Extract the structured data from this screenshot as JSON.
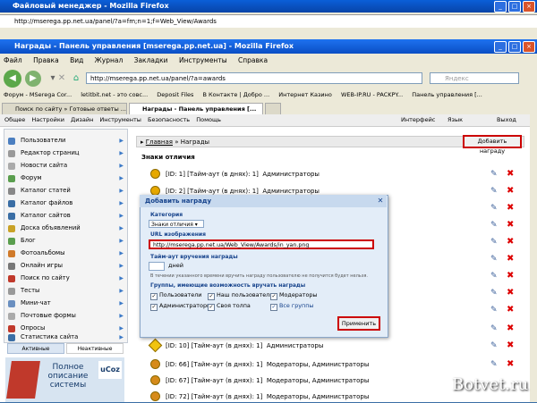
{
  "bg_window": {
    "title": "Файловый менеджер - Mozilla Firefox",
    "url": "http://mserega.pp.net.ua/panel/?a=fm;n=1;f=Web_View/Awards"
  },
  "window": {
    "title": "Награды - Панель управления [mserega.pp.net.ua] - Mozilla Firefox",
    "menu": [
      "Файл",
      "Правка",
      "Вид",
      "Журнал",
      "Закладки",
      "Инструменты",
      "Справка"
    ],
    "url": "http://mserega.pp.net.ua/panel/?a=awards",
    "search_placeholder": "Яндекс"
  },
  "bookmarks": [
    "Форум - MSerega Cor...",
    "letitbit.net - это совс...",
    "Deposit Files",
    "В Контакте | Добро ...",
    "Интернет Казино",
    "WEB-IP.RU - PACKPY...",
    "Панель управления [..."
  ],
  "tabs": [
    "Поиск по сайту » Готовые ответы ...",
    "Награды - Панель управления [...",
    ""
  ],
  "adminbar": {
    "left": [
      "Общее",
      "Настройки",
      "Дизайн",
      "Инструменты",
      "Безопасность",
      "Помощь"
    ],
    "interface_label": "Интерфейс",
    "lang_label": "Язык",
    "exit_label": "Выход"
  },
  "sidebar": {
    "items": [
      "Пользователи",
      "Редактор страниц",
      "Новости сайта",
      "Форум",
      "Каталог статей",
      "Каталог файлов",
      "Каталог сайтов",
      "Доска объявлений",
      "Блог",
      "Фотоальбомы",
      "Онлайн игры",
      "Поиск по сайту",
      "Тесты",
      "Мини-чат",
      "Почтовые формы",
      "Опросы",
      "Статистика сайта"
    ],
    "tab_active": "Активные",
    "tab_inactive": "Неактивные",
    "ad_text": "Полное описание системы"
  },
  "content": {
    "crumb_home": "Главная",
    "crumb_current": "Награды",
    "add_button": "Добавить награду",
    "section_title": "Знаки отличия",
    "rows": [
      {
        "id_text": "[ID: 1] [Тайм-аут (в днях): 1]",
        "group": "Администраторы"
      },
      {
        "id_text": "[ID: 2] [Тайм-аут (в днях): 1]",
        "group": "Администраторы"
      },
      {
        "id_text": "[ID: 10] [Тайм-аут (в днях): 1]",
        "group": "Администраторы"
      },
      {
        "id_text": "[ID: 66] [Тайм-аут (в днях): 1]",
        "group": "Модераторы, Администраторы"
      },
      {
        "id_text": "[ID: 67] [Тайм-аут (в днях): 1]",
        "group": "Модераторы, Администраторы"
      },
      {
        "id_text": "[ID: 72] [Тайм-аут (в днях): 1]",
        "group": "Модераторы, Администраторы"
      }
    ]
  },
  "modal": {
    "title": "Добавить награду",
    "category_label": "Категория",
    "category_value": "Знаки отличия",
    "url_label": "URL изображения",
    "url_value": "http://mserega.pp.net.ua/Web_View/Awards/in_yan.png",
    "timeout_label": "Тайм-аут вручения награды",
    "timeout_unit": "дней",
    "timeout_hint": "В течении указанного времени вручить награду пользователю не получится будет нельзя.",
    "groups_label": "Группы, имеющие возможность вручать награды",
    "groups": [
      "Пользователи",
      "Наш пользователь",
      "Модераторы",
      "Администраторы",
      "Своя толпа",
      "Все группы"
    ],
    "apply_button": "Применить"
  },
  "watermark": "Botvet.ru"
}
